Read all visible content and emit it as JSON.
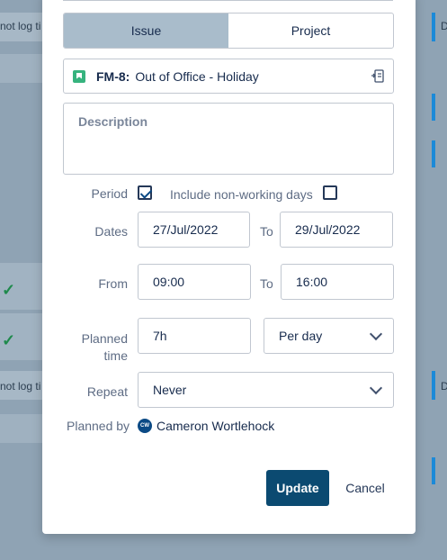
{
  "background": {
    "row_text_1": "not log ti",
    "row_text_2": "not log ti",
    "right_letter_1": "D",
    "right_letter_2": "D",
    "check_glyph": "✓"
  },
  "modal": {
    "tabs": [
      {
        "label": "Issue",
        "active": true
      },
      {
        "label": "Project",
        "active": false
      }
    ],
    "issue": {
      "key": "FM-8:",
      "summary": "Out of Office - Holiday",
      "type_icon": "bookmark-icon",
      "link_icon": "open-issue-icon"
    },
    "description_placeholder": "Description",
    "period": {
      "label": "Period",
      "checked": true,
      "include_label": "Include non-working days",
      "include_checked": false
    },
    "dates": {
      "label": "Dates",
      "start": "27/Jul/2022",
      "to_label": "To",
      "end": "29/Jul/2022"
    },
    "time": {
      "label": "From",
      "start": "09:00",
      "to_label": "To",
      "end": "16:00"
    },
    "planned_time": {
      "label_line1": "Planned",
      "label_line2": "time",
      "value": "7h",
      "unit": "Per day"
    },
    "repeat": {
      "label": "Repeat",
      "value": "Never"
    },
    "planned_by": {
      "label": "Planned by",
      "avatar_initials": "CW",
      "name": "Cameron Wortlehock"
    },
    "buttons": {
      "update": "Update",
      "cancel": "Cancel"
    }
  },
  "colors": {
    "primary": "#0b4a71",
    "active_tab": "#a9bccb",
    "issue_icon": "#36b37e"
  }
}
